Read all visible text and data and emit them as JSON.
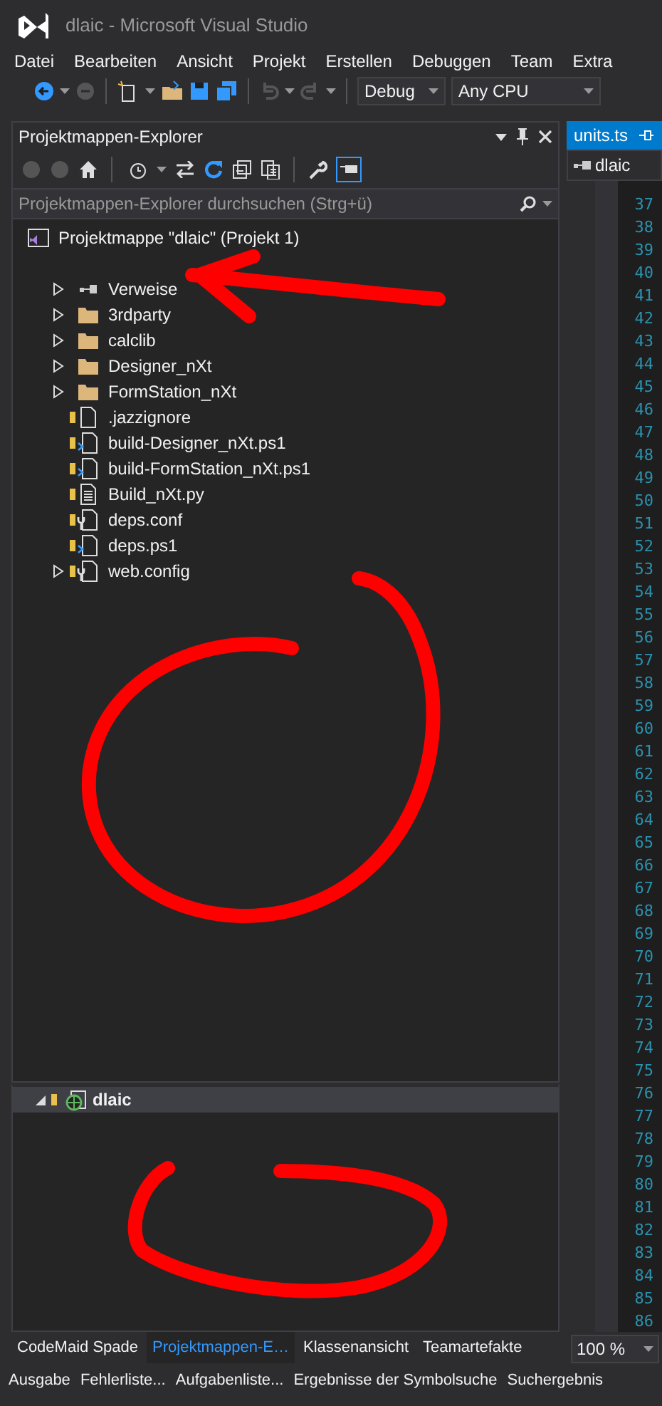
{
  "window": {
    "title": "dlaic - Microsoft Visual Studio"
  },
  "menu": [
    "Datei",
    "Bearbeiten",
    "Ansicht",
    "Projekt",
    "Erstellen",
    "Debuggen",
    "Team",
    "Extra"
  ],
  "toolbar": {
    "configuration": "Debug",
    "platform": "Any CPU"
  },
  "solution_explorer": {
    "title": "Projektmappen-Explorer",
    "preview_active": true,
    "search": {
      "placeholder": "Projektmappen-Explorer durchsuchen (Strg+ü)"
    },
    "root": "Projektmappe \"dlaic\" (Projekt 1)",
    "items": [
      {
        "label": "Verweise",
        "kind": "references",
        "expandable": true,
        "locked": false
      },
      {
        "label": "3rdparty",
        "kind": "folder",
        "expandable": true,
        "locked": false
      },
      {
        "label": "calclib",
        "kind": "folder",
        "expandable": true,
        "locked": false
      },
      {
        "label": "Designer_nXt",
        "kind": "folder",
        "expandable": true,
        "locked": false
      },
      {
        "label": "FormStation_nXt",
        "kind": "folder",
        "expandable": true,
        "locked": false
      },
      {
        "label": ".jazzignore",
        "kind": "file",
        "expandable": false,
        "locked": true
      },
      {
        "label": "build-Designer_nXt.ps1",
        "kind": "script",
        "expandable": false,
        "locked": true
      },
      {
        "label": "build-FormStation_nXt.ps1",
        "kind": "script",
        "expandable": false,
        "locked": true
      },
      {
        "label": "Build_nXt.py",
        "kind": "text",
        "expandable": false,
        "locked": true
      },
      {
        "label": "deps.conf",
        "kind": "config",
        "expandable": false,
        "locked": true
      },
      {
        "label": "deps.ps1",
        "kind": "script",
        "expandable": false,
        "locked": true
      },
      {
        "label": "web.config",
        "kind": "config",
        "expandable": true,
        "locked": true
      }
    ],
    "lower_pane": {
      "label": "dlaic",
      "expanded": true
    }
  },
  "editor": {
    "tab": "units.ts",
    "navigation": "dlaic",
    "line_numbers": [
      "37",
      "38",
      "39",
      "40",
      "41",
      "42",
      "43",
      "44",
      "45",
      "46",
      "47",
      "48",
      "49",
      "50",
      "51",
      "52",
      "53",
      "54",
      "55",
      "56",
      "57",
      "58",
      "59",
      "60",
      "61",
      "62",
      "63",
      "64",
      "65",
      "66",
      "67",
      "68",
      "69",
      "70",
      "71",
      "72",
      "73",
      "74",
      "75",
      "76",
      "77",
      "78",
      "79",
      "80",
      "81",
      "82",
      "83",
      "84",
      "85",
      "86"
    ],
    "zoom": "100 %"
  },
  "panel_tabs": [
    {
      "label": "CodeMaid Spade",
      "selected": false
    },
    {
      "label": "Projektmappen-E…",
      "selected": true
    },
    {
      "label": "Klassenansicht",
      "selected": false
    },
    {
      "label": "Teamartefakte",
      "selected": false
    }
  ],
  "bottom_tabs": [
    "Ausgabe",
    "Fehlerliste...",
    "Aufgabenliste...",
    "Ergebnisse der Symbolsuche",
    "Suchergebnis"
  ],
  "annotations": [
    {
      "kind": "arrow"
    },
    {
      "kind": "loop"
    },
    {
      "kind": "small_loop"
    }
  ]
}
